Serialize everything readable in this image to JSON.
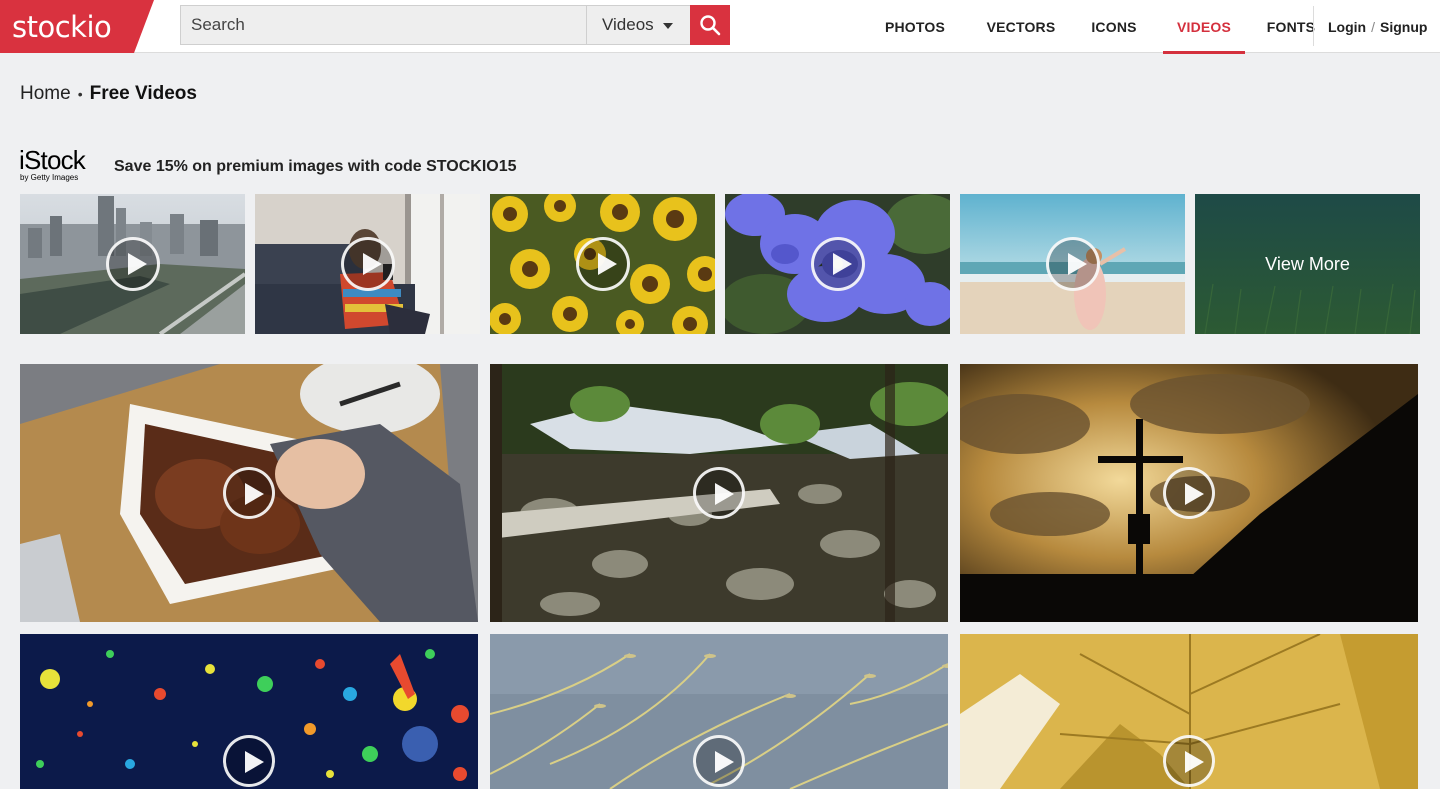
{
  "header": {
    "logo_text": "stockio",
    "search": {
      "placeholder": "Search",
      "value": "",
      "category_selected": "Videos"
    },
    "nav": [
      {
        "label": "PHOTOS",
        "active": false
      },
      {
        "label": "VECTORS",
        "active": false
      },
      {
        "label": "ICONS",
        "active": false
      },
      {
        "label": "VIDEOS",
        "active": true
      },
      {
        "label": "FONTS",
        "active": false
      }
    ],
    "login_label": "Login",
    "auth_separator": "/",
    "signup_label": "Signup"
  },
  "breadcrumb": {
    "home": "Home",
    "separator": "•",
    "current": "Free Videos"
  },
  "sponsor": {
    "brand": "iStock",
    "brand_sub": "by Getty Images",
    "promo_text": "Save 15% on premium images with code STOCKIO15"
  },
  "sponsored_videos": [
    {
      "subject": "city-aerial"
    },
    {
      "subject": "woman-with-phone"
    },
    {
      "subject": "sunflowers"
    },
    {
      "subject": "blue-pansy"
    },
    {
      "subject": "beach-woman"
    }
  ],
  "view_more_label": "View More",
  "free_videos": [
    {
      "subject": "food-in-dish"
    },
    {
      "subject": "forest-stream"
    },
    {
      "subject": "cross-silhouette-sunset"
    },
    {
      "subject": "paint-dots"
    },
    {
      "subject": "grass-seeds"
    },
    {
      "subject": "yellow-leaf"
    }
  ],
  "colors": {
    "brand_red": "#d9323f",
    "page_background": "#eff0f2",
    "nav_active": "#d4303d"
  }
}
